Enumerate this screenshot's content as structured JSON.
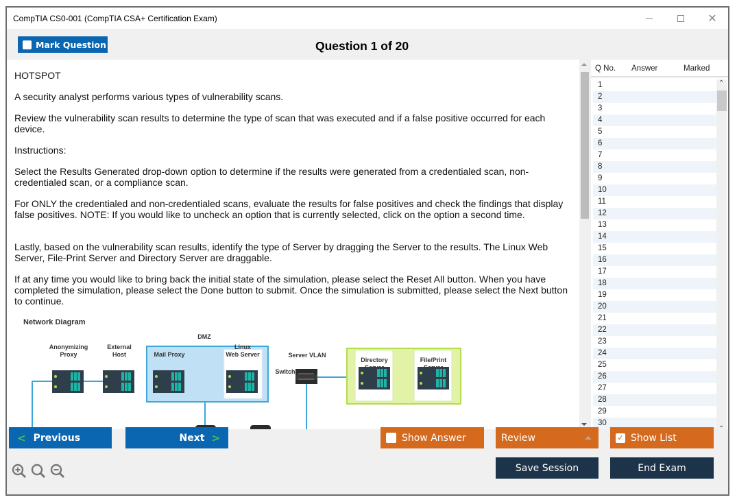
{
  "window": {
    "title": "CompTIA CS0-001 (CompTIA CSA+ Certification Exam)",
    "controls": [
      "minimize-icon",
      "maximize-icon",
      "close-icon"
    ]
  },
  "header": {
    "mark_question_label": "Mark Question",
    "mark_question_checked": false,
    "question_counter": "Question 1 of 20"
  },
  "question": {
    "type_label": "HOTSPOT",
    "paragraphs": [
      "A security analyst performs various types of vulnerability scans.",
      "Review the vulnerability scan results to determine the type of scan that was executed and if a false positive occurred for each device.",
      "Instructions:",
      "Select the Results Generated drop-down option to determine if the results were generated from a credentialed scan, non-credentialed scan, or a compliance scan.",
      "For ONLY the credentialed and non-credentialed scans, evaluate the results for false positives and check the findings that display false positives. NOTE: If you would like to uncheck an option that is currently selected, click on the option a second time.",
      "Lastly, based on the vulnerability scan results, identify the type of Server by dragging the Server to the results. The Linux Web Server, File-Print Server and Directory Server are draggable.",
      "If at any time you would like to bring back the initial state of the simulation, please select the Reset All button. When you have completed the simulation, please select the Done button to submit. Once the simulation is submitted, please select the Next button to continue."
    ],
    "diagram": {
      "title": "Network Diagram",
      "dmz_label": "DMZ",
      "server_vlan_label": "Server VLAN",
      "switch_label": "Switch",
      "nodes": {
        "anonymizing_proxy": [
          "Anonymizing",
          "Proxy"
        ],
        "external_host": [
          "External",
          "Host"
        ],
        "mail_proxy": [
          "Mail Proxy"
        ],
        "linux_web_server": [
          "Linux",
          "Web Server"
        ],
        "directory_server": [
          "Directory",
          "Server"
        ],
        "file_print_server": [
          "File/Print",
          "Server"
        ]
      },
      "colors": {
        "dmz_fill": "#bfe0f5",
        "dmz_border": "#3ea7d9",
        "vlan_fill": "#e2f2a6",
        "vlan_border": "#b5dc4c",
        "server_body": "#2e3e4b",
        "server_slot": "#1fb5a6",
        "server_led": "#b5dc4c",
        "link": "#3ea7d9"
      }
    }
  },
  "question_list": {
    "columns": [
      "Q No.",
      "Answer",
      "Marked"
    ],
    "rows": [
      "1",
      "2",
      "3",
      "4",
      "5",
      "6",
      "7",
      "8",
      "9",
      "10",
      "11",
      "12",
      "13",
      "14",
      "15",
      "16",
      "17",
      "18",
      "19",
      "20",
      "21",
      "22",
      "23",
      "24",
      "25",
      "26",
      "27",
      "28",
      "29",
      "30"
    ]
  },
  "footer": {
    "previous_label": "Previous",
    "next_label": "Next",
    "show_answer_label": "Show Answer",
    "show_answer_checked": false,
    "review_label": "Review",
    "show_list_label": "Show List",
    "show_list_checked": true,
    "save_session_label": "Save Session",
    "end_exam_label": "End Exam",
    "zoom_icons": [
      "zoom-in-icon",
      "zoom-reset-icon",
      "zoom-out-icon"
    ]
  },
  "colors": {
    "primary_blue": "#0b66b2",
    "orange": "#d56a1f",
    "navy": "#1c3349",
    "chevron_green": "#3fcf3f"
  }
}
